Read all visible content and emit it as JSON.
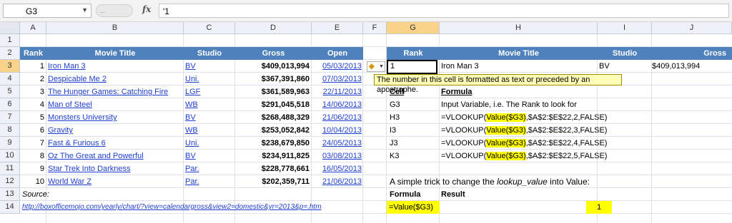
{
  "formula_bar": {
    "name_box": "G3",
    "dots": "...",
    "fx": "fx",
    "value": "'1"
  },
  "columns": [
    "A",
    "B",
    "C",
    "D",
    "E",
    "F",
    "G",
    "H",
    "I",
    "J"
  ],
  "rows": [
    "1",
    "2",
    "3",
    "4",
    "5",
    "6",
    "7",
    "8",
    "9",
    "10",
    "11",
    "12",
    "13",
    "14"
  ],
  "table": {
    "headers": [
      "Rank",
      "Movie Title",
      "Studio",
      "Gross",
      "Open"
    ],
    "rows": [
      {
        "rank": "1",
        "title": "Iron Man 3",
        "studio": "BV",
        "gross": "$409,013,994",
        "open": "05/03/2013"
      },
      {
        "rank": "2",
        "title": "Despicable Me 2",
        "studio": "Uni.",
        "gross": "$367,391,860",
        "open": "07/03/2013"
      },
      {
        "rank": "3",
        "title": "The Hunger Games: Catching Fire",
        "studio": "LGF",
        "gross": "$361,589,963",
        "open": "22/11/2013"
      },
      {
        "rank": "4",
        "title": "Man of Steel",
        "studio": "WB",
        "gross": "$291,045,518",
        "open": "14/06/2013"
      },
      {
        "rank": "5",
        "title": "Monsters University",
        "studio": "BV",
        "gross": "$268,488,329",
        "open": "21/06/2013"
      },
      {
        "rank": "6",
        "title": "Gravity",
        "studio": "WB",
        "gross": "$253,052,842",
        "open": "10/04/2013"
      },
      {
        "rank": "7",
        "title": "Fast & Furious 6",
        "studio": "Uni.",
        "gross": "$238,679,850",
        "open": "24/05/2013"
      },
      {
        "rank": "8",
        "title": "Oz The Great and Powerful",
        "studio": "BV",
        "gross": "$234,911,825",
        "open": "03/08/2013"
      },
      {
        "rank": "9",
        "title": "Star Trek Into Darkness",
        "studio": "Par.",
        "gross": "$228,778,661",
        "open": "16/05/2013"
      },
      {
        "rank": "10",
        "title": "World War Z",
        "studio": "Par.",
        "gross": "$202,359,711",
        "open": "21/06/2013"
      }
    ],
    "source_label": "Source:",
    "source_url": "http://boxofficemojo.com/yearly/chart/?view=calendargross&view2=domestic&yr=2013&p=.htm"
  },
  "lookup": {
    "headers": [
      "Rank",
      "Movie Title",
      "Studio",
      "Gross"
    ],
    "rank_value": "1",
    "title": "Iron Man 3",
    "studio": "BV",
    "gross": "$409,013,994"
  },
  "warning_tooltip": "The number in this cell is formatted as text or preceded by an apostrophe.",
  "notes": {
    "cell_header": "Cell",
    "formula_header": "Formula",
    "rows": [
      {
        "cell": "G3",
        "pre": "Input Variable, i.e. The Rank to look for",
        "hl": "",
        "post": ""
      },
      {
        "cell": "H3",
        "pre": "=VLOOKUP(",
        "hl": "Value($G3)",
        "post": ",$A$2:$E$22,2,FALSE)"
      },
      {
        "cell": "I3",
        "pre": "=VLOOKUP(",
        "hl": "Value($G3)",
        "post": ",$A$2:$E$22,3,FALSE)"
      },
      {
        "cell": "J3",
        "pre": "=VLOOKUP(",
        "hl": "Value($G3)",
        "post": ",$A$2:$E$22,4,FALSE)"
      },
      {
        "cell": "K3",
        "pre": "=VLOOKUP(",
        "hl": "Value($G3)",
        "post": ",$A$2:$E$22,5,FALSE)"
      }
    ],
    "trick_pre": "A simple trick to change the ",
    "trick_em": "lookup_value",
    "trick_post": " into Value:",
    "formula_label": "Formula",
    "result_label": "Result",
    "example_formula": "=Value($G3)",
    "example_result": "1"
  },
  "colors": {
    "header_blue": "#4f81bd",
    "highlight": "#ffff00",
    "tooltip_bg": "#ffffb8",
    "selected_header": "#f9d38a"
  }
}
